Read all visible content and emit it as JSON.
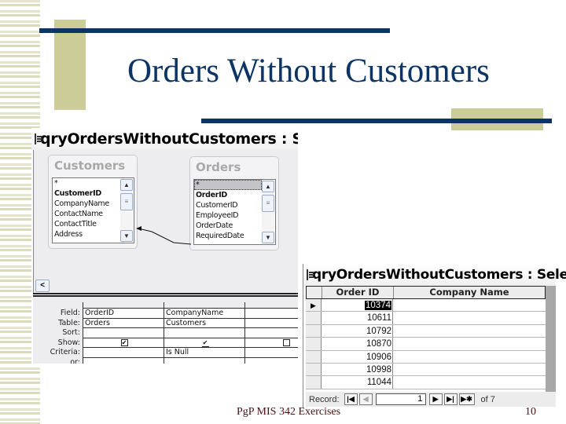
{
  "slide": {
    "title": "Orders Without Customers",
    "footer": "PgP MIS 342 Exercises",
    "page_number": "10",
    "colors": {
      "accent_navy": "#0c3464",
      "accent_olive": "#cccc99",
      "footer_text": "#4a1010"
    }
  },
  "design_window": {
    "title": "qryOrdersWithoutCustomers : Select Qu",
    "icon": "query-design-icon",
    "tables": [
      {
        "name": "Customers",
        "fields": [
          "*",
          "CustomerID",
          "CompanyName",
          "ContactName",
          "ContactTitle",
          "Address"
        ],
        "bold_index": 1
      },
      {
        "name": "Orders",
        "fields": [
          "*",
          "OrderID",
          "CustomerID",
          "EmployeeID",
          "OrderDate",
          "RequiredDate"
        ],
        "bold_index": 1,
        "selected_index": 0
      }
    ],
    "grid": {
      "row_labels": [
        "Field:",
        "Table:",
        "Sort:",
        "Show:",
        "Criteria:",
        "or:"
      ],
      "columns": [
        {
          "field": "OrderID",
          "table": "Orders",
          "sort": "",
          "show": true,
          "criteria": "",
          "or": ""
        },
        {
          "field": "CompanyName",
          "table": "Customers",
          "sort": "",
          "show": true,
          "criteria": "Is Null",
          "or": ""
        },
        {
          "field": "",
          "table": "",
          "sort": "",
          "show": false,
          "criteria": "",
          "or": ""
        }
      ]
    }
  },
  "datasheet_window": {
    "title": "qryOrdersWithoutCustomers : Select",
    "icon": "datasheet-icon",
    "columns": [
      "Order ID",
      "Company Name"
    ],
    "rows": [
      {
        "order_id": "10374",
        "company_name": ""
      },
      {
        "order_id": "10611",
        "company_name": ""
      },
      {
        "order_id": "10792",
        "company_name": ""
      },
      {
        "order_id": "10870",
        "company_name": ""
      },
      {
        "order_id": "10906",
        "company_name": ""
      },
      {
        "order_id": "10998",
        "company_name": ""
      },
      {
        "order_id": "11044",
        "company_name": ""
      }
    ],
    "navigation": {
      "label": "Record:",
      "current": "1",
      "of_label": "of 7",
      "buttons": {
        "first": "|◀",
        "prev": "◀",
        "next": "▶",
        "last": "▶|",
        "new": "▶✱"
      }
    }
  }
}
